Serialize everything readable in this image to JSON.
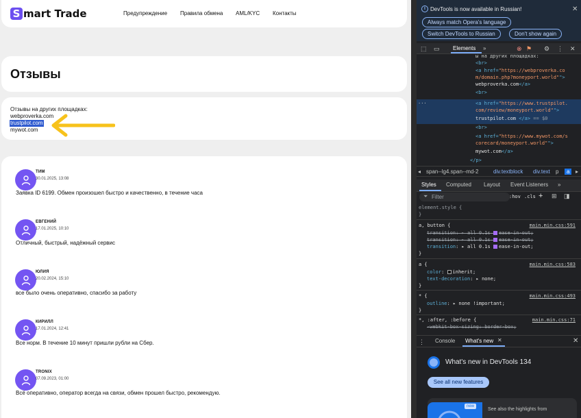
{
  "site": {
    "logo_letter": "S",
    "logo_text": "mart Trade",
    "nav": [
      "Предупреждение",
      "Правила обмена",
      "AML/KYC",
      "Контакты"
    ],
    "page_title": "Отзывы",
    "links_intro": "Отзывы на других площадках:",
    "links": [
      "webproverka.com",
      "trustpilot.com",
      "mywot.com"
    ],
    "reviews": [
      {
        "name": "ТИМ",
        "date": "30.01.2025, 13:08",
        "text": "Заявка ID 6199. Обмен произошел быстро и качественно, в течение часа"
      },
      {
        "name": "ЕВГЕНИЙ",
        "date": "17.01.2025, 10:10",
        "text": "Отличный, быстрый, надёжный сервис"
      },
      {
        "name": "ЮЛИЯ",
        "date": "20.02.2024, 15:10",
        "text": "все было очень оперативно, спасибо за работу"
      },
      {
        "name": "КИРИЛЛ",
        "date": "17.01.2024, 12:41",
        "text": "Все норм. В течение 10 минут пришли рубли на Сбер."
      },
      {
        "name": "TRONIX",
        "date": "07.09.2023, 01:00",
        "text": "Всё оперативно, оператор всегда на связи, обмен прошел быстро, рекомендую."
      }
    ]
  },
  "devtools": {
    "infobar_text": "DevTools is now available in Russian!",
    "infobar_buttons": [
      "Always match Opera's language",
      "Switch DevTools to Russian",
      "Don't show again"
    ],
    "main_tab": "Elements",
    "more_tabs": "»",
    "badge_error": "",
    "dom_lines": {
      "l0": "ы на других площадках:",
      "br": "<br>",
      "a_open": "<a href=",
      "close_quote": "\">",
      "a_close": "</a>",
      "href1a": "\"https://webproverka.co",
      "href1b": "m/domain.php?moneyport.world\"",
      "text1": "webproverka.com",
      "href2a": "\"https://www.trustpilot.",
      "href2b": "com/review/moneyport.world\"",
      "text2": "trustpilot.com",
      "sel_suffix": " == $0",
      "href3a": "\"https://www.mywot.com/s",
      "href3b": "corecard/moneyport.world\"",
      "text3": "mywot.com",
      "p_close": "</p>",
      "ellipsis": "···"
    },
    "breadcrumbs": [
      "span--lg4.span--md-2",
      "div.textblock",
      "div.text",
      "p",
      "a"
    ],
    "style_tabs": [
      "Styles",
      "Computed",
      "Layout",
      "Event Listeners",
      "»"
    ],
    "filter_placeholder": "Filter",
    "filter_tools": [
      ":hov",
      ".cls",
      "+"
    ],
    "styles": {
      "element_style": "element.style {",
      "close": "}",
      "rule1_sel": "a, button {",
      "rule1_src": "main.min.css:591",
      "transition_prop": "transition",
      "transition_val": "all 0.1s",
      "transition_ease": "ease-in-out;",
      "rule2_sel": "a {",
      "rule2_src": "main.min.css:583",
      "color_prop": "color",
      "color_val": "inherit;",
      "td_prop": "text-decoration",
      "td_val": "none;",
      "rule3_sel": "* {",
      "rule3_src": "main.min.css:493",
      "outline_prop": "outline",
      "outline_val": "none !important;",
      "rule4_sel": "*, :after, :before {",
      "rule4_src": "main.min.css:71",
      "bs_prop": "-webkit-box-sizing",
      "bs_val": "border-box;"
    },
    "drawer_tabs": [
      "Console",
      "What's new"
    ],
    "whats_new_title": "What's new in DevTools 134",
    "see_all": "See all new features",
    "new_badge": "new",
    "see_highlights": "See also the highlights from"
  },
  "colors": {
    "accent": "#6c4ff0",
    "selection": "#2f5bd0",
    "arrow": "#f7c21b"
  }
}
